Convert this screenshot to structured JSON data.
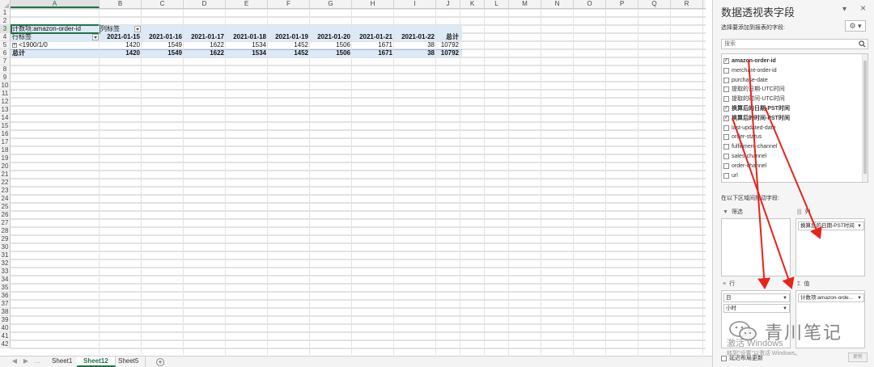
{
  "sheet": {
    "columns": [
      "A",
      "B",
      "C",
      "D",
      "E",
      "F",
      "G",
      "H",
      "I",
      "J",
      "K",
      "L",
      "M",
      "N",
      "O",
      "P",
      "Q",
      "R"
    ],
    "selected_column": "A",
    "rows": [
      "1",
      "2",
      "3",
      "4",
      "5",
      "6",
      "7",
      "8",
      "9",
      "10",
      "11",
      "12",
      "13",
      "14",
      "15",
      "16",
      "17",
      "18",
      "19",
      "20",
      "21",
      "22",
      "23",
      "24",
      "25",
      "26",
      "27",
      "28",
      "29",
      "30",
      "31",
      "32",
      "33",
      "34",
      "35",
      "36",
      "37",
      "38",
      "39",
      "40",
      "41",
      "42"
    ],
    "selected_row": "3"
  },
  "pivot": {
    "value_header": "计数项:amazon-order-id",
    "col_labels_header": "列标签",
    "row_labels_header": "行标签",
    "dates": [
      "2021-01-15",
      "2021-01-16",
      "2021-01-17",
      "2021-01-18",
      "2021-01-19",
      "2021-01-20",
      "2021-01-21",
      "2021-01-22"
    ],
    "total_header": "总计",
    "row_item_label": "<1900/1/0",
    "row_item_values": [
      "1420",
      "1549",
      "1622",
      "1534",
      "1452",
      "1506",
      "1671",
      "38",
      "10792"
    ],
    "total_label": "总计",
    "total_values": [
      "1420",
      "1549",
      "1622",
      "1534",
      "1452",
      "1506",
      "1671",
      "38",
      "10792"
    ]
  },
  "tabs": {
    "items": [
      "Sheet1",
      "Sheet12",
      "Sheet5"
    ],
    "active": "Sheet12"
  },
  "pane": {
    "title": "数据透视表字段",
    "subtitle": "选择要添加到报表的字段:",
    "search_placeholder": "搜索",
    "fields": [
      {
        "label": "amazon-order-id",
        "checked": true,
        "bold": true
      },
      {
        "label": "merchant-order-id",
        "checked": false,
        "bold": false
      },
      {
        "label": "purchase-date",
        "checked": false,
        "bold": false
      },
      {
        "label": "提取的日期-UTC时间",
        "checked": false,
        "bold": false
      },
      {
        "label": "提取的时间-UTC时间",
        "checked": false,
        "bold": false
      },
      {
        "label": "换算后的日期-PST时间",
        "checked": true,
        "bold": true
      },
      {
        "label": "换算后的时间-PST时间",
        "checked": true,
        "bold": true
      },
      {
        "label": "last-updated-date",
        "checked": false,
        "bold": false
      },
      {
        "label": "order-status",
        "checked": false,
        "bold": false
      },
      {
        "label": "fulfillment-channel",
        "checked": false,
        "bold": false
      },
      {
        "label": "sales-channel",
        "checked": false,
        "bold": false
      },
      {
        "label": "order-channel",
        "checked": false,
        "bold": false
      },
      {
        "label": "url",
        "checked": false,
        "bold": false
      }
    ],
    "areas_label": "在以下区域间拖动字段:",
    "filter_label": "筛选",
    "columns_label": "列",
    "rows_label": "行",
    "values_label": "值",
    "columns_chip": "换算后的日期-PST时间",
    "rows_chips": [
      "日",
      "小时"
    ],
    "values_chip": "计数项:amazon-orde...",
    "defer_label": "延迟布局更新",
    "update_label": "更新",
    "close_glyph": "×",
    "menu_glyph": "▾",
    "gear_glyph": "⚙ ▾"
  },
  "overlay": {
    "watermark": "青川笔记",
    "activation_line1": "激活 Windows",
    "activation_line2": "转到\"设置\"以激活 Windows。",
    "arrow_color": "#e8231c"
  }
}
